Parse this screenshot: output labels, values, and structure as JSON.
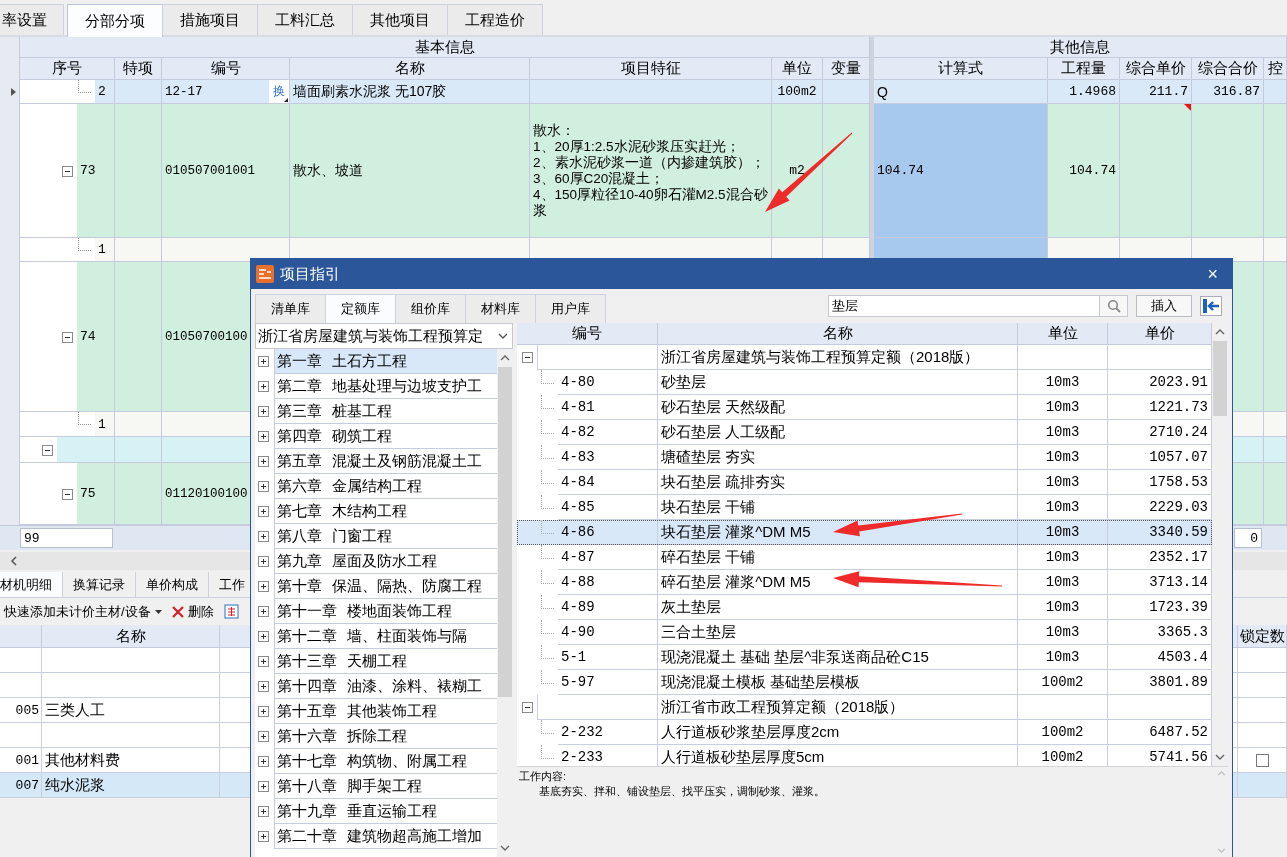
{
  "top_tabs": [
    {
      "label": "率设置",
      "selected": false
    },
    {
      "label": "分部分项",
      "selected": true
    },
    {
      "label": "措施项目",
      "selected": false
    },
    {
      "label": "工料汇总",
      "selected": false
    },
    {
      "label": "其他项目",
      "selected": false
    },
    {
      "label": "工程造价",
      "selected": false
    }
  ],
  "main_table": {
    "groups": [
      "基本信息",
      "其他信息"
    ],
    "columns": [
      "序号",
      "特项",
      "编号",
      "名称",
      "项目特征",
      "单位",
      "变量",
      "计算式",
      "工程量",
      "综合单价",
      "综合合价",
      "控"
    ],
    "rows": [
      {
        "kind": "sub",
        "current": true,
        "note": false,
        "formula_selected": false,
        "index": "2",
        "code": "12-17",
        "swap": "换",
        "name": "墙面刷素水泥浆 无107胶",
        "unit": "100m2",
        "formula": "Q",
        "quantity": "1.4968",
        "unit_price": "211.7",
        "total": "316.87"
      },
      {
        "kind": "item",
        "current": false,
        "note": true,
        "formula_selected": true,
        "expanded": true,
        "index": "73",
        "code": "010507001001",
        "name": "散水、坡道",
        "features": "散水：\n1、20厚1:2.5水泥砂浆压实赶光；\n2、素水泥砂浆一道（内掺建筑胶）；\n3、60厚C20混凝土；\n4、150厚粒径10-40卵石灌M2.5混合砂浆",
        "unit": "m2",
        "formula": "104.74",
        "quantity": "104.74"
      },
      {
        "kind": "sub",
        "current": false,
        "note": false,
        "formula_selected": true,
        "index": "1"
      },
      {
        "kind": "item",
        "current": false,
        "expanded": true,
        "index": "74",
        "code": "01050700100"
      },
      {
        "kind": "sub",
        "current": false,
        "index": "1"
      },
      {
        "kind": "section",
        "current": false,
        "expanded": true
      },
      {
        "kind": "item",
        "current": false,
        "expanded": true,
        "index": "75",
        "code": "01120100100"
      }
    ],
    "footer": {
      "count": "99",
      "value": "0"
    }
  },
  "detail_panel": {
    "tabs": [
      {
        "label": "材机明细",
        "selected": true
      },
      {
        "label": "换算记录",
        "selected": false
      },
      {
        "label": "单价构成",
        "selected": false
      },
      {
        "label": "工作",
        "selected": false
      }
    ],
    "toolbar": {
      "add_label": "快速添加未计价主材/设备",
      "delete_label": "删除"
    },
    "columns": [
      "名称",
      "锁定数"
    ],
    "rows": [
      {
        "selected": false
      },
      {
        "selected": false
      },
      {
        "code": "005",
        "name": "三类人工",
        "selected": false
      },
      {
        "selected": false
      },
      {
        "code": "001",
        "name": "其他材料费",
        "selected": false,
        "locked": false
      },
      {
        "code": "007",
        "name": "纯水泥浆",
        "selected": true
      }
    ]
  },
  "dialog": {
    "title": "项目指引",
    "close": "×",
    "tabs": [
      {
        "label": "清单库",
        "selected": false
      },
      {
        "label": "定额库",
        "selected": true
      },
      {
        "label": "组价库",
        "selected": false
      },
      {
        "label": "材料库",
        "selected": false
      },
      {
        "label": "用户库",
        "selected": false
      }
    ],
    "search": {
      "value": "垫层"
    },
    "insert_button": "插入",
    "library": "浙江省房屋建筑与装饰工程预算定",
    "chapters": [
      {
        "label": "第一章 土石方工程",
        "selected": true,
        "expanded": false
      },
      {
        "label": "第二章 地基处理与边坡支护工",
        "selected": false,
        "expanded": false
      },
      {
        "label": "第三章 桩基工程",
        "selected": false,
        "expanded": false
      },
      {
        "label": "第四章 砌筑工程",
        "selected": false,
        "expanded": false
      },
      {
        "label": "第五章 混凝土及钢筋混凝土工",
        "selected": false,
        "expanded": false
      },
      {
        "label": "第六章 金属结构工程",
        "selected": false,
        "expanded": false
      },
      {
        "label": "第七章 木结构工程",
        "selected": false,
        "expanded": false
      },
      {
        "label": "第八章 门窗工程",
        "selected": false,
        "expanded": false
      },
      {
        "label": "第九章 屋面及防水工程",
        "selected": false,
        "expanded": false
      },
      {
        "label": "第十章 保温、隔热、防腐工程",
        "selected": false,
        "expanded": false
      },
      {
        "label": "第十一章 楼地面装饰工程",
        "selected": false,
        "expanded": false
      },
      {
        "label": "第十二章 墙、柱面装饰与隔",
        "selected": false,
        "expanded": false
      },
      {
        "label": "第十三章 天棚工程",
        "selected": false,
        "expanded": false
      },
      {
        "label": "第十四章 油漆、涂料、裱糊工",
        "selected": false,
        "expanded": false
      },
      {
        "label": "第十五章 其他装饰工程",
        "selected": false,
        "expanded": false
      },
      {
        "label": "第十六章 拆除工程",
        "selected": false,
        "expanded": false
      },
      {
        "label": "第十七章 构筑物、附属工程",
        "selected": false,
        "expanded": false
      },
      {
        "label": "第十八章 脚手架工程",
        "selected": false,
        "expanded": false
      },
      {
        "label": "第十九章 垂直运输工程",
        "selected": false,
        "expanded": false
      },
      {
        "label": "第二十章 建筑物超高施工增加",
        "selected": false,
        "expanded": false
      }
    ],
    "table": {
      "columns": [
        "编号",
        "名称",
        "单位",
        "单价"
      ],
      "groups": [
        {
          "name": "浙江省房屋建筑与装饰工程预算定额（2018版）",
          "expanded": true,
          "children": [
            {
              "code": "4-80",
              "name": "砂垫层",
              "unit": "10m3",
              "price": "2023.91",
              "selected": false
            },
            {
              "code": "4-81",
              "name": "砂石垫层 天然级配",
              "unit": "10m3",
              "price": "1221.73",
              "selected": false
            },
            {
              "code": "4-82",
              "name": "砂石垫层 人工级配",
              "unit": "10m3",
              "price": "2710.24",
              "selected": false
            },
            {
              "code": "4-83",
              "name": "塘碴垫层 夯实",
              "unit": "10m3",
              "price": "1057.07",
              "selected": false
            },
            {
              "code": "4-84",
              "name": "块石垫层 疏排夯实",
              "unit": "10m3",
              "price": "1758.53",
              "selected": false
            },
            {
              "code": "4-85",
              "name": "块石垫层 干铺",
              "unit": "10m3",
              "price": "2229.03",
              "selected": false
            },
            {
              "code": "4-86",
              "name": "块石垫层 灌浆^DM M5",
              "unit": "10m3",
              "price": "3340.59",
              "selected": true
            },
            {
              "code": "4-87",
              "name": "碎石垫层 干铺",
              "unit": "10m3",
              "price": "2352.17",
              "selected": false
            },
            {
              "code": "4-88",
              "name": "碎石垫层 灌浆^DM M5",
              "unit": "10m3",
              "price": "3713.14",
              "selected": false
            },
            {
              "code": "4-89",
              "name": "灰土垫层",
              "unit": "10m3",
              "price": "1723.39",
              "selected": false
            },
            {
              "code": "4-90",
              "name": "三合土垫层",
              "unit": "10m3",
              "price": "3365.3",
              "selected": false
            },
            {
              "code": "5-1",
              "name": "现浇混凝土 基础 垫层^非泵送商品砼C15",
              "unit": "10m3",
              "price": "4503.4",
              "selected": false
            },
            {
              "code": "5-97",
              "name": "现浇混凝土模板 基础垫层模板",
              "unit": "100m2",
              "price": "3801.89",
              "selected": false
            }
          ]
        },
        {
          "name": "浙江省市政工程预算定额（2018版）",
          "expanded": true,
          "children": [
            {
              "code": "2-232",
              "name": "人行道板砂浆垫层厚度2cm",
              "unit": "100m2",
              "price": "6487.52",
              "selected": false
            },
            {
              "code": "2-233",
              "name": "人行道板砂垫层厚度5cm",
              "unit": "100m2",
              "price": "5741.56",
              "selected": false
            }
          ]
        }
      ]
    },
    "work_content": {
      "label": "工作内容:",
      "text": "基底夯实、拌和、铺设垫层、找平压实，调制砂浆、灌浆。"
    }
  }
}
